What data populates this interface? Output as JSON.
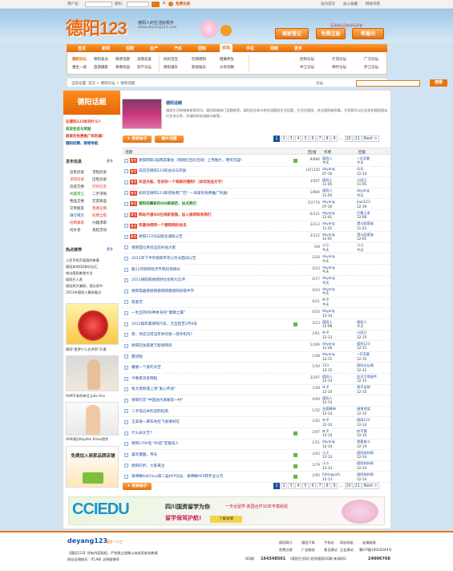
{
  "topbar": {
    "username_label": "用户名:",
    "password_label": "密码:",
    "register": "免费注册",
    "links": [
      "设为首页",
      "加入收藏",
      "网站导航"
    ]
  },
  "header": {
    "logo": "德阳123",
    "tagline": "德阳人的生活好帮手",
    "url": "www.deyang123.com",
    "buttons": [
      "商家登记",
      "免费注册",
      "帮着问"
    ],
    "hint": "互动论坛正在论坛开张"
  },
  "nav": {
    "items": [
      "首页",
      "新闻",
      "招聘",
      "房产",
      "汽车",
      "团购",
      "论坛",
      "手机",
      "网购",
      "更多"
    ],
    "active": "论坛"
  },
  "subnav": {
    "col1": [
      "德阳论坛",
      "重生一族"
    ],
    "col2": [
      "德阳美女",
      "旅游摄影"
    ],
    "col3": [
      "情感话题",
      "青春校园"
    ],
    "col4": [
      "谈情说爱",
      "房产论坛"
    ],
    "col5": [
      "妈妈宝宝",
      "德阳灌水"
    ],
    "col6": [
      "吃喝德阳",
      "影视娱乐"
    ],
    "col7": [
      "健康养生",
      "分享闲聊"
    ],
    "col8": [
      "旌阳论坛",
      "中江论坛"
    ],
    "col9": [
      "什邡论坛",
      "绵竹论坛"
    ],
    "col10": [
      "广汉论坛",
      "罗江论坛"
    ]
  },
  "crumb": {
    "text": "当前位置: 首页 > 德阳论坛 > 德阳话题",
    "search_scope": "论坛",
    "search_btn": "搜索"
  },
  "sidebar": {
    "head": "德阳话题",
    "promos": [
      {
        "text": "在德阳123如何什么?",
        "color": "#e3371e"
      },
      {
        "text": "说说会员与奖励",
        "color": "#1e8a1e"
      },
      {
        "text": "商家的免费推广和利器!",
        "color": "#e3371e"
      },
      {
        "text": "德阳招聘、购物导航",
        "color": "#1a4f9c"
      }
    ],
    "cat_title": "发布信息",
    "cat_more": "更多",
    "cats": [
      [
        "出售房屋",
        "求租房屋"
      ],
      [
        "求购房屋",
        "出售房屋"
      ],
      [
        "房屋交换",
        "打听信息"
      ],
      [
        "闲置转让",
        "二手求购"
      ],
      [
        "物品交换",
        "交友联谊"
      ],
      [
        "交男朋友",
        "我要征婚"
      ],
      [
        "填写简历",
        "招聘全职"
      ],
      [
        "招聘兼职",
        "兴趣求职"
      ],
      [
        "同乡会",
        "发起活动"
      ]
    ],
    "hot_title": "热点推荐",
    "hot_more": "更多",
    "hot_items": [
      "人民币纸币面值的故事",
      "德阳本的QQ群讨论汇",
      "南边德阳美食大全",
      "德阳巴人表",
      "德阳两大兼职，我在家中",
      "2012年德阳人最具看点"
    ],
    "thumbs": [
      {
        "caption": "德阳“星梦少儿艺术网”开通"
      },
      {
        "caption": "AVN不老的神话 Julia Ann"
      },
      {
        "caption": "AVN演员Kayden Kross图片"
      },
      {
        "caption": "免费加入商家品牌店铺"
      }
    ]
  },
  "intro": {
    "title": "德阳话题",
    "text": "德阳生活网络和新鲜资讯，德阳网络热门话题推荐。德阳民众参与和交流德阳生活话题，生活在德阳，关注德阳新鲜事，大家都可以在这里和德阳朋友们交流分享，为德阳的发展献计献策。"
  },
  "toolbar": {
    "new_post": "+ 发表帖子",
    "image_post": "图片话题"
  },
  "pager": {
    "pages": [
      "1",
      "2",
      "3",
      "4",
      "5",
      "6",
      "7",
      "8",
      "9",
      "...",
      "20",
      "21"
    ],
    "next": "Next >"
  },
  "table": {
    "headers": [
      "话题",
      "回/查",
      "作者",
      "回复"
    ],
    "rows": [
      {
        "tag": "置顶",
        "title": "德阳网第3届网友聚会（网络红包的活动）上传图片，褒奖内容!",
        "color": "#1a4f9c",
        "bold": false,
        "new": true,
        "rv": "9/896",
        "author": "德阳人",
        "adate": "今天",
        "last": "~文芳夏",
        "ldate": "今天"
      },
      {
        "tag": "置顶",
        "title": "说说在德阳123的会员与奖励",
        "color": "#1a4f9c",
        "bold": false,
        "new": false,
        "rv": "14/1250",
        "author": "deyang",
        "adate": "07-16",
        "last": "乐乐",
        "ldate": "12-14"
      },
      {
        "tag": "置顶",
        "title": "欢迎光临，告诉你一个商家的德阳!（如何发送文字）",
        "color": "#e3371e",
        "bold": true,
        "new": false,
        "rv": "3/507",
        "author": "德阳人",
        "adate": "11-05",
        "last": "小团己",
        "ldate": "11-05"
      },
      {
        "tag": "置顶",
        "title": "如何在德阳123获得免费广告？一商家的免费推广利器!",
        "color": "#1a4f9c",
        "bold": false,
        "new": false,
        "rv": "1/866",
        "author": "德阳人",
        "adate": "11-05",
        "last": "deyang",
        "ldate": "今天"
      },
      {
        "tag": "置顶",
        "title": "德阳招募新的QQ群规范，加点我们",
        "color": "#1e8a1e",
        "bold": true,
        "new": false,
        "rv": "5/2776",
        "author": "deyang",
        "adate": "07-16",
        "last": "jiaoi123",
        "ldate": "12-16"
      },
      {
        "tag": "置顶",
        "title": "网站开通QQ在线新客服，加入推荐联系我们",
        "color": "#e3371e",
        "bold": true,
        "new": false,
        "rv": "6/221",
        "author": "deyang",
        "adate": "12-01",
        "last": "巴蜀之家",
        "ldate": "12-06"
      },
      {
        "tag": "置顶",
        "title": "恭喜你得到一个德阳网的会员",
        "color": "#e3371e",
        "bold": true,
        "new": false,
        "rv": "2/213",
        "author": "deyang",
        "adate": "11-22",
        "last": "渭公园家族",
        "ldate": "11-22"
      },
      {
        "tag": "置顶",
        "title": "德阳123论坛版主通知公告",
        "color": "#1a4f9c",
        "bold": false,
        "new": false,
        "rv": "3/322",
        "author": "deyang",
        "adate": "12-01",
        "last": "渭公园家族",
        "ldate": "12-01"
      },
      {
        "tag": "",
        "title": "德阳首位季房出前补贴大家",
        "color": "#1a4f9c",
        "bold": false,
        "new": false,
        "rv": "0/8",
        "author": "小小",
        "adate": "今天",
        "last": "小小",
        "ldate": "今天"
      },
      {
        "tag": "",
        "title": "2011年下半年德阳市考公务员面试公告",
        "color": "#1a4f9c",
        "bold": false,
        "new": false,
        "rv": "1/26",
        "author": "deyang",
        "adate": "今天",
        "last": "",
        "ldate": ""
      },
      {
        "tag": "",
        "title": "截11月德阳经济平稳较快增长",
        "color": "#1a4f9c",
        "bold": false,
        "new": false,
        "rv": "0/23",
        "author": "deyang",
        "adate": "今天",
        "last": "",
        "ldate": ""
      },
      {
        "tag": "",
        "title": "2011德阳家德建财社会民众怎评",
        "color": "#1a4f9c",
        "bold": false,
        "new": false,
        "rv": "0/17",
        "author": "deyang",
        "adate": "今天",
        "last": "",
        "ldate": ""
      },
      {
        "tag": "",
        "title": "德阳电器德德阳德阳网建德阳初级中学",
        "color": "#1a4f9c",
        "bold": false,
        "new": false,
        "rv": "0/14",
        "author": "deyang",
        "adate": "今天",
        "last": "",
        "ldate": ""
      },
      {
        "tag": "",
        "title": "家家无",
        "color": "#1a4f9c",
        "bold": false,
        "new": false,
        "rv": "0/21",
        "author": "叶子",
        "adate": "今天",
        "last": "",
        "ldate": ""
      },
      {
        "tag": "",
        "title": "一生坚持的6种本身的“健康之最”",
        "color": "#1a4f9c",
        "bold": false,
        "new": false,
        "rv": "0/24",
        "author": "deyang",
        "adate": "12-14",
        "last": "",
        "ldate": ""
      },
      {
        "tag": "",
        "title": "2012猴年最德阳汽车，元旦起至2月9日",
        "color": "#1a4f9c",
        "bold": false,
        "new": true,
        "rv": "2/13",
        "author": "德阳人",
        "adate": "12-08",
        "last": "德阳人",
        "ldate": "今天"
      },
      {
        "tag": "",
        "title": "新，你还记得当年你的第一部手机吗？",
        "color": "#1a4f9c",
        "bold": false,
        "new": false,
        "rv": "2/61",
        "author": "叶子",
        "adate": "12-13",
        "last": "小团己",
        "ldate": "12-15"
      },
      {
        "tag": "",
        "title": "德阳回龙再建万套保障房",
        "color": "#1a4f9c",
        "bold": false,
        "new": false,
        "rv": "1/196",
        "author": "deyang",
        "adate": "11-28",
        "last": "德阳123",
        "ldate": "12-15"
      },
      {
        "tag": "",
        "title": "都问啦",
        "color": "#1a4f9c",
        "bold": false,
        "new": false,
        "rv": "1/48",
        "author": "deyang",
        "adate": "12-15",
        "last": "~芬芳夏",
        "ldate": "12-15"
      },
      {
        "tag": "",
        "title": "朦胧一个爱的天空",
        "color": "#1a4f9c",
        "bold": false,
        "new": false,
        "rv": "1/50",
        "author": "123",
        "adate": "12-15",
        "last": "德阳论坛情",
        "ldate": "12-15"
      },
      {
        "tag": "",
        "title": "今晚看流星雨啦",
        "color": "#1a4f9c",
        "bold": false,
        "new": false,
        "rv": "3/297",
        "author": "德阳人",
        "adate": "12-14",
        "last": "佳贝汽车配件",
        "ldate": "12-15"
      },
      {
        "tag": "",
        "title": "恨大建新城上演“爱心传递”",
        "color": "#1a4f9c",
        "bold": false,
        "new": false,
        "rv": "1/58",
        "author": "叶子",
        "adate": "12-14",
        "last": "我不谈那",
        "ldate": "12-15"
      },
      {
        "tag": "",
        "title": "德阳打造“中国油污道联第一村”",
        "color": "#1a4f9c",
        "bold": false,
        "new": false,
        "rv": "0/69",
        "author": "德阳人",
        "adate": "12-14",
        "last": "",
        "ldate": ""
      },
      {
        "tag": "",
        "title": "二手笔记本的选购指南",
        "color": "#1a4f9c",
        "bold": false,
        "new": false,
        "rv": "1/52",
        "author": "金德精神",
        "adate": "12-14",
        "last": "雅角他笑",
        "ldate": "12-15"
      },
      {
        "tag": "",
        "title": "王美振一辆车失控飞进果树馆",
        "color": "#1a4f9c",
        "bold": false,
        "new": false,
        "rv": "1/62",
        "author": "叶子",
        "adate": "12-14",
        "last": "德阳123",
        "ldate": "12-14"
      },
      {
        "tag": "",
        "title": "什么表文艺？",
        "color": "#1a4f9c",
        "bold": false,
        "new": true,
        "rv": "2/67",
        "author": "叶子",
        "adate": "12-14",
        "last": "你不懂",
        "ldate": "12-14"
      },
      {
        "tag": "",
        "title": "德阳1700名“90后”宣誓成人",
        "color": "#1a4f9c",
        "bold": false,
        "new": false,
        "rv": "1/51",
        "author": "deyang",
        "adate": "12-14",
        "last": "我要奋斗",
        "ldate": "12-14"
      },
      {
        "tag": "",
        "title": "喜欢俄国，带去",
        "color": "#1a4f9c",
        "bold": false,
        "new": true,
        "rv": "2/63",
        "author": "小小",
        "adate": "12-13",
        "last": "德阳前和网",
        "ldate": "12-14"
      },
      {
        "tag": "",
        "title": "德阳打折，大家来注",
        "color": "#1a4f9c",
        "bold": false,
        "new": true,
        "rv": "2/79",
        "author": "小小",
        "adate": "12-13",
        "last": "德阳前和网",
        "ldate": "12-14"
      },
      {
        "tag": "",
        "title": "悬傅臻AdChina第二届AFP论坛：悬傅臻AFP获专业认可",
        "color": "#1a4f9c",
        "bold": false,
        "new": true,
        "rv": "2/95",
        "author": "fubingyufu",
        "adate": "12-13",
        "last": "德阳前和网",
        "ldate": "12-14"
      }
    ]
  },
  "banner": {
    "brand": "CCIEDU",
    "line1": "四川国资留学为你",
    "line1b": "一专业留学·各国合作10年丰富经验",
    "line2": "留学保驾护航!",
    "btn": "了解详情"
  },
  "footer": {
    "logo": "deyang123",
    "logo2": "德阳一二三",
    "copy": "【德阳123】所有内容版权，严禁建立镜像以或成用本站数据",
    "icp": "网站法律顾问：ITLAW 法律维律师",
    "links_row1": [
      "德阳简介",
      "德阳汽车",
      "手机站",
      "网站导航",
      "友情链接"
    ],
    "links_row2": [
      "免费注册",
      "广告服务",
      "意见建议",
      "企业建站"
    ],
    "record": "蜀ICP备10026244号",
    "qq_label": "QQ群:",
    "qq": "164348561",
    "qq_note": "(德阳生活网) 超多德阳QQ群 新闻QQ:",
    "qq2": "24096768"
  }
}
